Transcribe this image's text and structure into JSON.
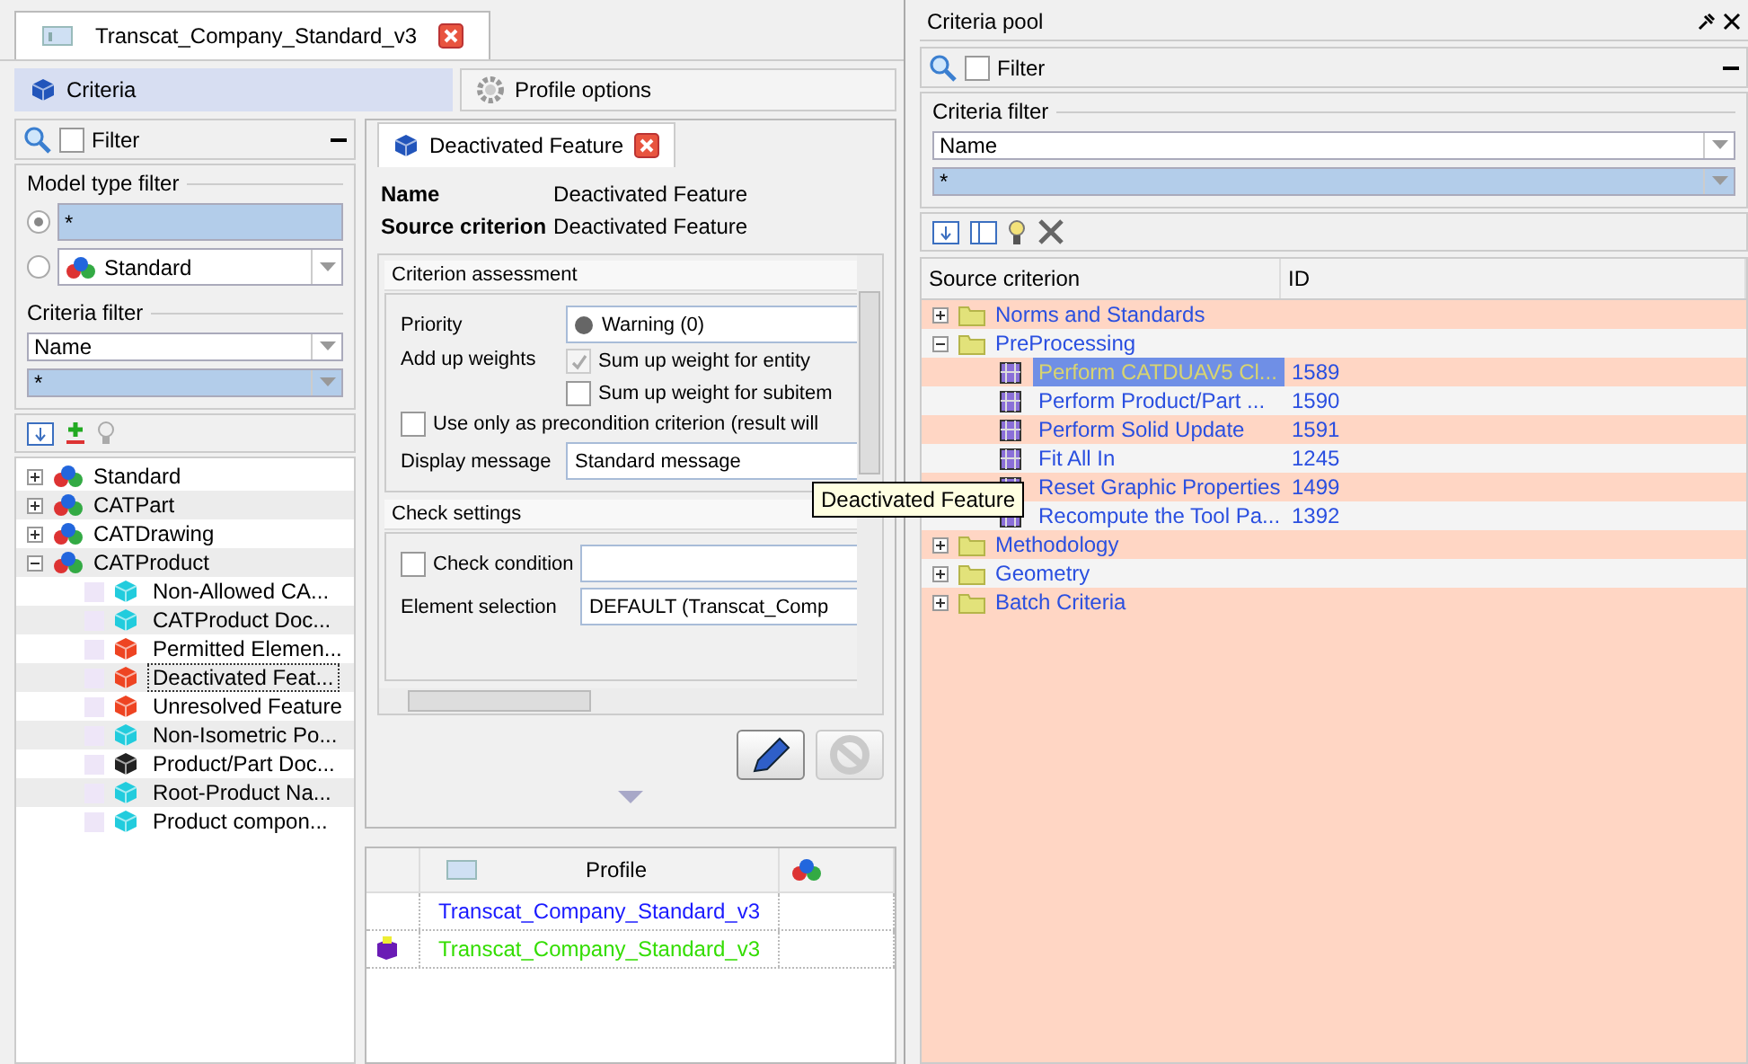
{
  "document_tab": {
    "title": "Transcat_Company_Standard_v3"
  },
  "view_tabs": [
    {
      "label": "Criteria",
      "selected": true,
      "kind": "cube"
    },
    {
      "label": "Profile options",
      "selected": false,
      "kind": "gear"
    }
  ],
  "left_panel": {
    "filter": {
      "label": "Filter",
      "checked": false
    },
    "model_type_filter": {
      "title": "Model type filter",
      "options": [
        {
          "value": "*",
          "selected": true,
          "kind": "field"
        },
        {
          "value": "Standard",
          "selected": false,
          "kind": "dropdown"
        }
      ]
    },
    "criteria_filter": {
      "title": "Criteria filter",
      "field": "Name",
      "pattern": "*"
    },
    "tree": [
      {
        "label": "Standard",
        "expanded": false
      },
      {
        "label": "CATPart",
        "expanded": false
      },
      {
        "label": "CATDrawing",
        "expanded": false
      },
      {
        "label": "CATProduct",
        "expanded": true,
        "children": [
          {
            "label": "Non-Allowed CA...",
            "color": "#22ccdd",
            "selected": false
          },
          {
            "label": "CATProduct Doc...",
            "color": "#22ccdd",
            "selected": false
          },
          {
            "label": "Permitted Elemen...",
            "color": "#ee4422",
            "selected": false
          },
          {
            "label": "Deactivated Feat...",
            "color": "#ee4422",
            "selected": true
          },
          {
            "label": "Unresolved Feature",
            "color": "#ee4422",
            "selected": false
          },
          {
            "label": "Non-Isometric Po...",
            "color": "#22ccdd",
            "selected": false
          },
          {
            "label": "Product/Part Doc...",
            "color": "#222222",
            "selected": false
          },
          {
            "label": "Root-Product Na...",
            "color": "#22ccdd",
            "selected": false
          },
          {
            "label": "Product compon...",
            "color": "#22ccdd",
            "selected": false
          }
        ]
      }
    ]
  },
  "editor": {
    "tab": {
      "title": "Deactivated Feature"
    },
    "properties": [
      {
        "label": "Name",
        "value": "Deactivated Feature"
      },
      {
        "label": "Source criterion",
        "value": "Deactivated Feature"
      }
    ],
    "criterion_assessment": {
      "title": "Criterion assessment",
      "priority": {
        "label": "Priority",
        "value": "Warning (0)"
      },
      "add_up_weights": {
        "label": "Add up weights",
        "options": [
          {
            "label": "Sum up weight for entity",
            "checked": true,
            "disabled": true
          },
          {
            "label": "Sum up weight for subitem",
            "checked": false,
            "disabled": false
          }
        ]
      },
      "precondition": {
        "label": "Use only as precondition criterion (result will",
        "checked": false
      },
      "display_message": {
        "label": "Display message",
        "value": "Standard message"
      }
    },
    "check_settings": {
      "title": "Check settings",
      "check_condition": {
        "label": "Check condition",
        "checked": false
      },
      "element_selection": {
        "label": "Element selection",
        "value": "DEFAULT (Transcat_Comp"
      }
    },
    "buttons": [
      {
        "kind": "edit",
        "disabled": false
      },
      {
        "kind": "reset",
        "disabled": true
      }
    ]
  },
  "profile_table": {
    "columns": [
      "Profile"
    ],
    "rows": [
      {
        "profile": "Transcat_Company_Standard_v3",
        "color": "#1a1aff",
        "current": false
      },
      {
        "profile": "Transcat_Company_Standard_v3",
        "color": "#33dd00",
        "current": true
      }
    ]
  },
  "tooltip": {
    "text": "Deactivated Feature"
  },
  "criteria_pool": {
    "title": "Criteria pool",
    "filter": {
      "label": "Filter",
      "checked": false
    },
    "criteria_filter": {
      "title": "Criteria filter",
      "field": "Name",
      "pattern": "*"
    },
    "columns": [
      "Source criterion",
      "ID"
    ],
    "tree": [
      {
        "label": "Norms and Standards",
        "expanded": false
      },
      {
        "label": "PreProcessing",
        "expanded": true,
        "children": [
          {
            "label": "Perform CATDUAV5 Cl...",
            "id": "1589",
            "selected": true
          },
          {
            "label": "Perform Product/Part ...",
            "id": "1590",
            "selected": false
          },
          {
            "label": "Perform Solid Update",
            "id": "1591",
            "selected": false
          },
          {
            "label": "Fit All In",
            "id": "1245",
            "selected": false
          },
          {
            "label": "Reset Graphic Properties",
            "id": "1499",
            "selected": false
          },
          {
            "label": "Recompute the Tool Pa...",
            "id": "1392",
            "selected": false
          }
        ]
      },
      {
        "label": "Methodology",
        "expanded": false
      },
      {
        "label": "Geometry",
        "expanded": false
      },
      {
        "label": "Batch Criteria",
        "expanded": false
      }
    ]
  }
}
